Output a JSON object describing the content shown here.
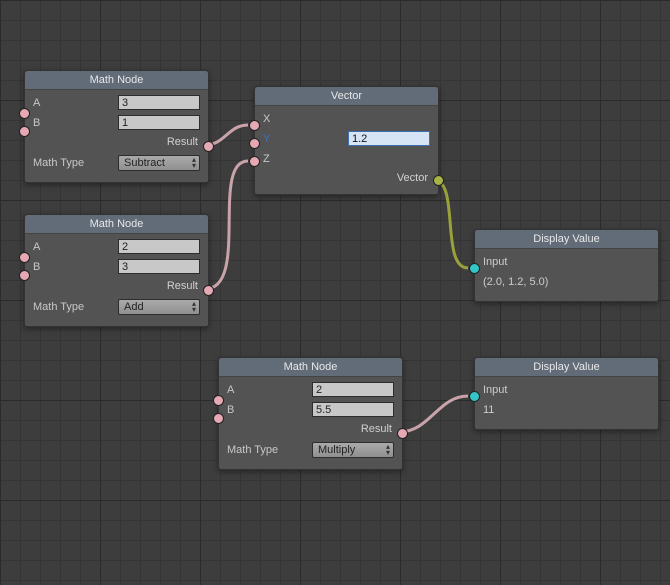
{
  "nodes": {
    "math1": {
      "title": "Math Node",
      "a": "3",
      "b": "1",
      "result_label": "Result",
      "mathtype_label": "Math Type",
      "mathtype_value": "Subtract"
    },
    "math2": {
      "title": "Math Node",
      "a": "2",
      "b": "3",
      "result_label": "Result",
      "mathtype_label": "Math Type",
      "mathtype_value": "Add"
    },
    "math3": {
      "title": "Math Node",
      "a": "2",
      "b": "5.5",
      "result_label": "Result",
      "mathtype_label": "Math Type",
      "mathtype_value": "Multiply"
    },
    "vector": {
      "title": "Vector",
      "x_label": "X",
      "y_label": "Y",
      "z_label": "Z",
      "y_value": "1.2",
      "output_label": "Vector"
    },
    "display1": {
      "title": "Display Value",
      "input_label": "Input",
      "value": "(2.0, 1.2, 5.0)"
    },
    "display2": {
      "title": "Display Value",
      "input_label": "Input",
      "value": "11"
    }
  }
}
